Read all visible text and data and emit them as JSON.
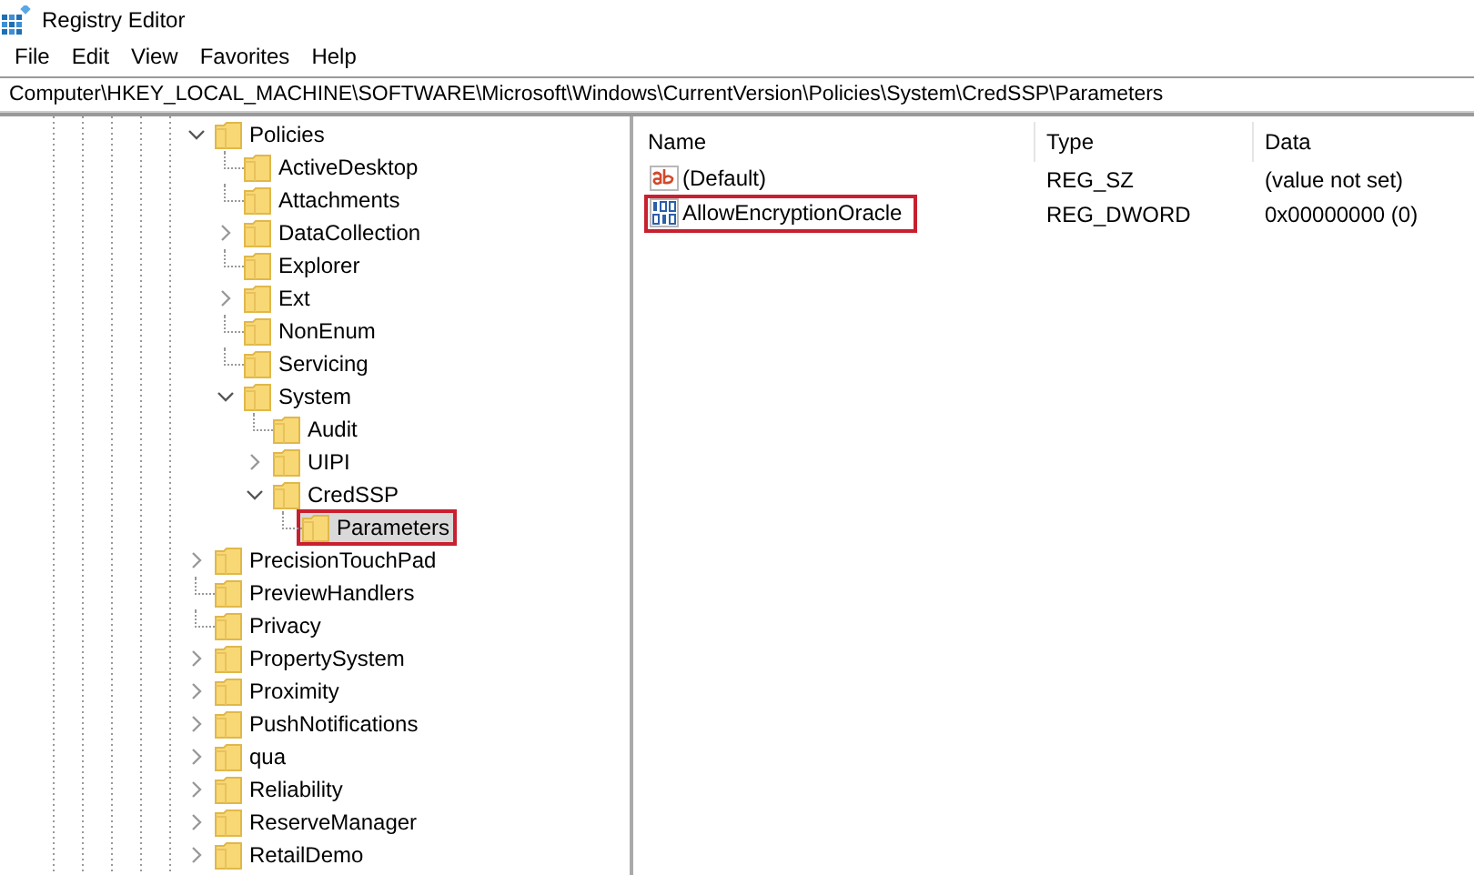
{
  "window": {
    "title": "Registry Editor"
  },
  "menu": [
    "File",
    "Edit",
    "View",
    "Favorites",
    "Help"
  ],
  "address": "Computer\\HKEY_LOCAL_MACHINE\\SOFTWARE\\Microsoft\\Windows\\CurrentVersion\\Policies\\System\\CredSSP\\Parameters",
  "tree": [
    {
      "label": "Policies",
      "expandable": true,
      "expanded": true,
      "selected": false,
      "highlighted": false,
      "children": [
        {
          "label": "ActiveDesktop",
          "expandable": false,
          "selected": false,
          "highlighted": false
        },
        {
          "label": "Attachments",
          "expandable": false,
          "selected": false,
          "highlighted": false
        },
        {
          "label": "DataCollection",
          "expandable": true,
          "expanded": false,
          "selected": false,
          "highlighted": false
        },
        {
          "label": "Explorer",
          "expandable": false,
          "selected": false,
          "highlighted": false
        },
        {
          "label": "Ext",
          "expandable": true,
          "expanded": false,
          "selected": false,
          "highlighted": false
        },
        {
          "label": "NonEnum",
          "expandable": false,
          "selected": false,
          "highlighted": false
        },
        {
          "label": "Servicing",
          "expandable": false,
          "selected": false,
          "highlighted": false
        },
        {
          "label": "System",
          "expandable": true,
          "expanded": true,
          "selected": false,
          "highlighted": false,
          "children": [
            {
              "label": "Audit",
              "expandable": false,
              "selected": false,
              "highlighted": false
            },
            {
              "label": "UIPI",
              "expandable": true,
              "expanded": false,
              "selected": false,
              "highlighted": false
            },
            {
              "label": "CredSSP",
              "expandable": true,
              "expanded": true,
              "selected": false,
              "highlighted": false,
              "children": [
                {
                  "label": "Parameters",
                  "expandable": false,
                  "selected": true,
                  "highlighted": true
                }
              ]
            }
          ]
        }
      ]
    },
    {
      "label": "PrecisionTouchPad",
      "expandable": true,
      "expanded": false,
      "selected": false,
      "highlighted": false
    },
    {
      "label": "PreviewHandlers",
      "expandable": false,
      "selected": false,
      "highlighted": false
    },
    {
      "label": "Privacy",
      "expandable": false,
      "selected": false,
      "highlighted": false
    },
    {
      "label": "PropertySystem",
      "expandable": true,
      "expanded": false,
      "selected": false,
      "highlighted": false
    },
    {
      "label": "Proximity",
      "expandable": true,
      "expanded": false,
      "selected": false,
      "highlighted": false
    },
    {
      "label": "PushNotifications",
      "expandable": true,
      "expanded": false,
      "selected": false,
      "highlighted": false
    },
    {
      "label": "qua",
      "expandable": true,
      "expanded": false,
      "selected": false,
      "highlighted": false
    },
    {
      "label": "Reliability",
      "expandable": true,
      "expanded": false,
      "selected": false,
      "highlighted": false
    },
    {
      "label": "ReserveManager",
      "expandable": true,
      "expanded": false,
      "selected": false,
      "highlighted": false
    },
    {
      "label": "RetailDemo",
      "expandable": true,
      "expanded": false,
      "selected": false,
      "highlighted": false
    }
  ],
  "values": {
    "columns": [
      "Name",
      "Type",
      "Data"
    ],
    "rows": [
      {
        "kind": "string",
        "name": "(Default)",
        "type": "REG_SZ",
        "data": "(value not set)",
        "highlighted": false
      },
      {
        "kind": "binary",
        "name": "AllowEncryptionOracle",
        "type": "REG_DWORD",
        "data": "0x00000000 (0)",
        "highlighted": true
      }
    ]
  }
}
